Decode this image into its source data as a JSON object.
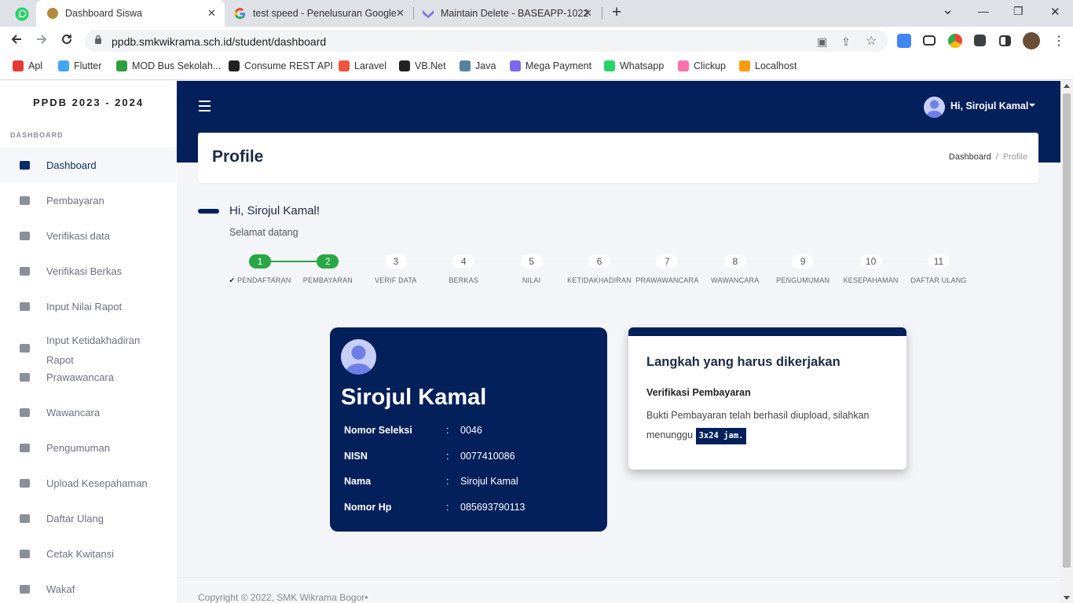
{
  "browser": {
    "pinned_tab_icon": "whatsapp-icon",
    "tabs": [
      {
        "title": "Dashboard Siswa",
        "icon": "school-favicon",
        "active": true
      },
      {
        "title": "test speed - Penelusuran Google",
        "icon": "google-icon",
        "active": false
      },
      {
        "title": "Maintain Delete - BASEAPP-1022",
        "icon": "clickup-icon",
        "active": false
      }
    ],
    "new_tab": "+",
    "window_controls": {
      "dropdown": "⌄",
      "minimize": "—",
      "restore": "❐",
      "close": "✕"
    },
    "url": "ppdb.smkwikrama.sch.id/student/dashboard",
    "bookmarks": [
      {
        "label": "Apl",
        "icon": "apps-grid-icon",
        "color": "#e53935"
      },
      {
        "label": "Flutter",
        "icon": "flutter-icon",
        "color": "#42a5f5"
      },
      {
        "label": "MOD Bus Sekolah...",
        "icon": "mod-icon",
        "color": "#2e9e3e"
      },
      {
        "label": "Consume REST API",
        "icon": "notion-icon",
        "color": "#222222"
      },
      {
        "label": "Laravel",
        "icon": "laravel-icon",
        "color": "#f05340"
      },
      {
        "label": "VB.Net",
        "icon": "notion-icon",
        "color": "#222222"
      },
      {
        "label": "Java",
        "icon": "java-icon",
        "color": "#5382a1"
      },
      {
        "label": "Mega Payment",
        "icon": "clickup-icon",
        "color": "#7b68ee"
      },
      {
        "label": "Whatsapp",
        "icon": "whatsapp-icon",
        "color": "#25d366"
      },
      {
        "label": "Clickup",
        "icon": "clickup-icon",
        "color": "#fd71af"
      },
      {
        "label": "Localhost",
        "icon": "pma-icon",
        "color": "#f89c0e"
      }
    ]
  },
  "sidebar": {
    "brand": "PPDB 2023 - 2024",
    "heading": "DASHBOARD",
    "items": [
      {
        "label": "Dashboard",
        "icon": "home-icon",
        "active": true
      },
      {
        "label": "Pembayaran",
        "icon": "money-icon"
      },
      {
        "label": "Verifikasi data",
        "icon": "book-icon"
      },
      {
        "label": "Verifikasi Berkas",
        "icon": "clipboard-check-icon"
      },
      {
        "label": "Input Nilai Rapot",
        "icon": "clipboard-check-icon"
      },
      {
        "label": "Input Ketidakhadiran Rapot",
        "icon": "clipboard-check-icon"
      },
      {
        "label": "Prawawancara",
        "icon": "laptop-icon"
      },
      {
        "label": "Wawancara",
        "icon": "clock-icon"
      },
      {
        "label": "Pengumuman",
        "icon": "megaphone-icon"
      },
      {
        "label": "Upload Kesepahaman",
        "icon": "book-icon"
      },
      {
        "label": "Daftar Ulang",
        "icon": "scroll-icon"
      },
      {
        "label": "Cetak Kwitansi",
        "icon": "print-icon"
      },
      {
        "label": "Wakaf",
        "icon": "money-icon"
      }
    ]
  },
  "topnav": {
    "user_greeting": "Hi, Sirojul Kamal"
  },
  "header": {
    "title": "Profile",
    "breadcrumb": {
      "home": "Dashboard",
      "separator": "/",
      "current": "Profile"
    }
  },
  "greeting": {
    "title": "Hi, Sirojul Kamal!",
    "subtitle": "Selamat datang"
  },
  "stepper": {
    "current_step": 2,
    "steps": [
      {
        "number": "1",
        "label": "PENDAFTARAN",
        "done": true,
        "checked": true
      },
      {
        "number": "2",
        "label": "PEMBAYARAN",
        "done": true
      },
      {
        "number": "3",
        "label": "VERIF DATA"
      },
      {
        "number": "4",
        "label": "BERKAS"
      },
      {
        "number": "5",
        "label": "NILAI"
      },
      {
        "number": "6",
        "label": "KETIDAKHADIRAN"
      },
      {
        "number": "7",
        "label": "PRAWAWANCARA"
      },
      {
        "number": "8",
        "label": "WAWANCARA"
      },
      {
        "number": "9",
        "label": "PENGUMUMAN"
      },
      {
        "number": "10",
        "label": "KESEPAHAMAN"
      },
      {
        "number": "11",
        "label": "DAFTAR ULANG"
      }
    ]
  },
  "profile": {
    "name": "Sirojul Kamal",
    "rows": [
      {
        "key": "Nomor Seleksi",
        "colon": ":",
        "value": "0046"
      },
      {
        "key": "NISN",
        "colon": ":",
        "value": "0077410086"
      },
      {
        "key": "Nama",
        "colon": ":",
        "value": "Sirojul Kamal"
      },
      {
        "key": "Nomor Hp",
        "colon": ":",
        "value": "085693790113"
      }
    ]
  },
  "task": {
    "title": "Langkah yang harus dikerjakan",
    "subtitle": "Verifikasi Pembayaran",
    "text": "Bukti Pembayaran telah berhasil diupload, silahkan menunggu",
    "badge": "3x24 jam."
  },
  "footer": {
    "text": "Copyright © 2022, SMK Wikrama Bogor•"
  },
  "colors": {
    "primary": "#03205b",
    "success": "#28a745",
    "background": "#f4f5f8"
  }
}
